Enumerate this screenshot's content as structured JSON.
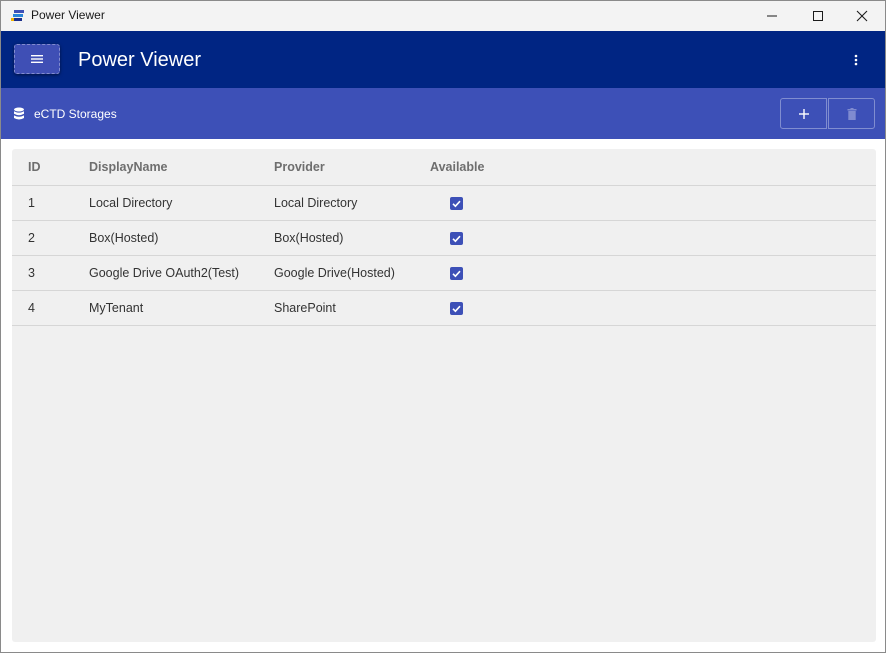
{
  "window": {
    "title": "Power Viewer",
    "controls": {
      "minimize": "—",
      "maximize": "☐",
      "close": "✕"
    }
  },
  "header": {
    "title": "Power Viewer",
    "menu_icon": "hamburger-icon",
    "more_icon": "more-vertical-icon"
  },
  "subheader": {
    "title": "eCTD Storages",
    "icon": "database-icon",
    "add_icon": "plus-icon",
    "delete_icon": "trash-icon"
  },
  "table": {
    "columns": [
      "ID",
      "DisplayName",
      "Provider",
      "Available"
    ],
    "rows": [
      {
        "id": "1",
        "display_name": "Local Directory",
        "provider": "Local Directory",
        "available": true
      },
      {
        "id": "2",
        "display_name": "Box(Hosted)",
        "provider": "Box(Hosted)",
        "available": true
      },
      {
        "id": "3",
        "display_name": "Google Drive OAuth2(Test)",
        "provider": "Google Drive(Hosted)",
        "available": true
      },
      {
        "id": "4",
        "display_name": "MyTenant",
        "provider": "SharePoint",
        "available": true
      }
    ]
  },
  "colors": {
    "header_bg": "#002583",
    "subheader_bg": "#3d50b7",
    "accent": "#3d50b7",
    "content_bg": "#f0f0f0"
  }
}
